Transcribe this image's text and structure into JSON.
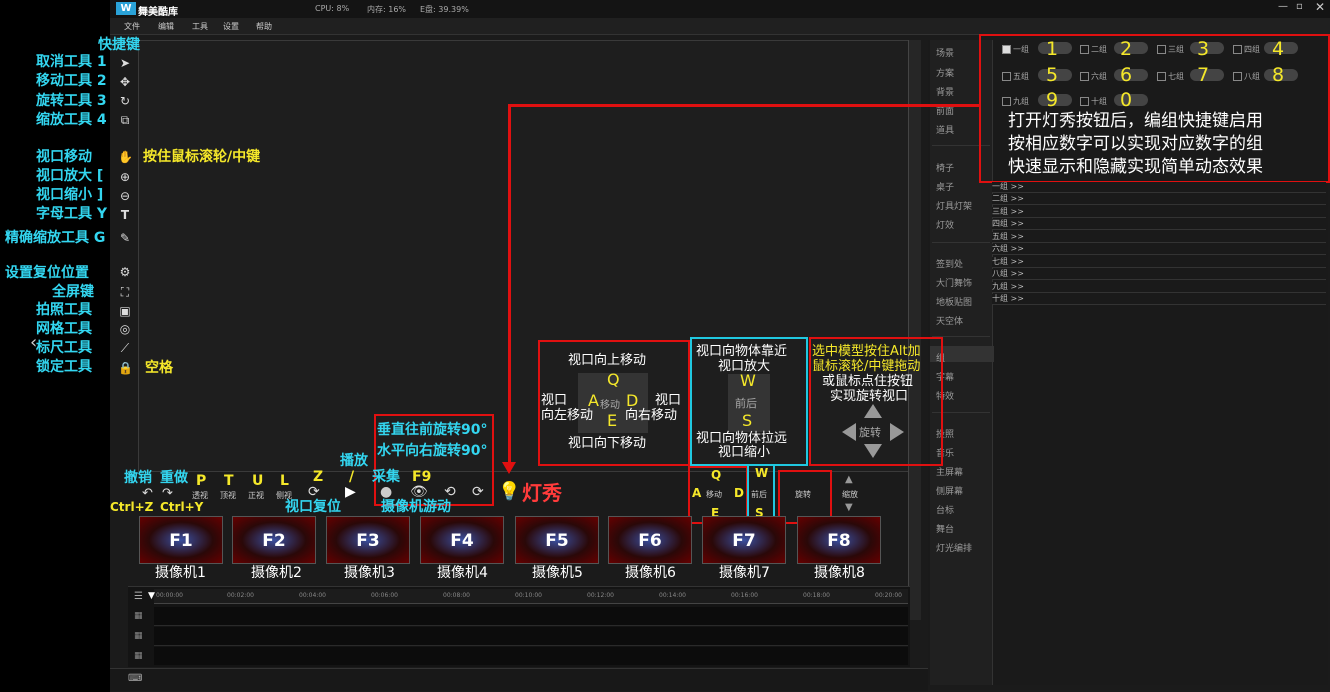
{
  "app": {
    "title": "舞美酷库",
    "cpu": "CPU: 8%",
    "mem": "内存: 16%",
    "disk": "E盘: 39.39%"
  },
  "menu": [
    "文件",
    "编辑",
    "工具",
    "设置",
    "帮助"
  ],
  "left_annotations": {
    "header": "快捷键",
    "items": [
      "取消工具 1",
      "移动工具 2",
      "旋转工具 3",
      "缩放工具 4",
      "视口移动",
      "视口放大 [",
      "视口缩小 ]",
      "字母工具 Y",
      "精确缩放工具 G",
      "设置复位位置",
      "全屏键",
      "拍照工具",
      "网格工具",
      "标尺工具",
      "锁定工具"
    ],
    "hand_note": "按住鼠标滚轮/中键",
    "space_note": "空格"
  },
  "right_sidebar": {
    "group1": [
      "场景",
      "方案",
      "背景",
      "前面",
      "道具"
    ],
    "group2": [
      "椅子",
      "桌子",
      "灯具灯架",
      "灯效"
    ],
    "group3": [
      "签到处",
      "大门舞饰",
      "地板贴图",
      "天空体"
    ],
    "group4": [
      "组",
      "字幕",
      "特效"
    ],
    "group5": [
      "投照",
      "音乐",
      "主屏幕",
      "侧屏幕",
      "台标",
      "舞台",
      "灯光编排"
    ]
  },
  "groups": {
    "checks": [
      "一组",
      "二组",
      "三组",
      "四组",
      "五组",
      "六组",
      "七组",
      "八组",
      "九组",
      "十组"
    ],
    "numbers": [
      "1",
      "2",
      "3",
      "4",
      "5",
      "6",
      "7",
      "8",
      "9",
      "0"
    ],
    "rows": [
      "一组 >>",
      "二组 >>",
      "三组 >>",
      "四组 >>",
      "五组 >>",
      "六组 >>",
      "七组 >>",
      "八组 >>",
      "九组 >>",
      "十组 >>"
    ],
    "annotation": [
      "打开灯秀按钮后，编组快捷键启用",
      "按相应数字可以实现对应数字的组",
      "快速显示和隐藏实现简单动态效果"
    ]
  },
  "nav_box": {
    "up": "视口向上移动",
    "left1": "视口",
    "left2": "向左移动",
    "right1": "视口",
    "right2": "向右移动",
    "down": "视口向下移动",
    "q": "Q",
    "a": "A",
    "d": "D",
    "e": "E",
    "center": "移动"
  },
  "zoom_box": {
    "top1": "视口向物体靠近",
    "top2": "视口放大",
    "w": "W",
    "center": "前后",
    "s": "S",
    "bot1": "视口向物体拉远",
    "bot2": "视口缩小"
  },
  "rotate_box": {
    "l1": "选中模型按住Alt加",
    "l2": "鼠标滚轮/中键拖动",
    "l3": "或鼠标点住按钮",
    "l4": "实现旋转视口",
    "center": "旋转"
  },
  "rot90": {
    "v": "垂直往前旋转90°",
    "h": "水平向右旋转90°"
  },
  "toolbar": {
    "undo": "撤销",
    "redo": "重做",
    "undo_key": "Ctrl+Z",
    "redo_key": "Ctrl+Y",
    "views": [
      {
        "k": "P",
        "l": "透视"
      },
      {
        "k": "T",
        "l": "顶视"
      },
      {
        "k": "U",
        "l": "正视"
      },
      {
        "k": "L",
        "l": "侧视"
      }
    ],
    "z": "Z",
    "reset": "视口复位",
    "play": "播放",
    "slash": "/",
    "capture": "采集",
    "f9": "F9",
    "roam": "摄像机游动",
    "lightshow": "灯秀",
    "small": {
      "q": "Q",
      "a": "A",
      "move": "移动",
      "d": "D",
      "e": "E",
      "w": "W",
      "fb": "前后",
      "s": "S",
      "rot": "旋转",
      "scale": "缩放"
    }
  },
  "cameras": [
    {
      "key": "F1",
      "label": "摄像机1"
    },
    {
      "key": "F2",
      "label": "摄像机2"
    },
    {
      "key": "F3",
      "label": "摄像机3"
    },
    {
      "key": "F4",
      "label": "摄像机4"
    },
    {
      "key": "F5",
      "label": "摄像机5"
    },
    {
      "key": "F6",
      "label": "摄像机6"
    },
    {
      "key": "F7",
      "label": "摄像机7"
    },
    {
      "key": "F8",
      "label": "摄像机8"
    }
  ],
  "timeline": {
    "ticks": [
      "00:00:00",
      "00:02:00",
      "00:04:00",
      "00:06:00",
      "00:08:00",
      "00:10:00",
      "00:12:00",
      "00:14:00",
      "00:16:00",
      "00:18:00",
      "00:20:00"
    ]
  },
  "colors": {
    "cyan": "#33d6f0",
    "yellow": "#f5e82a",
    "red": "#e01010"
  }
}
